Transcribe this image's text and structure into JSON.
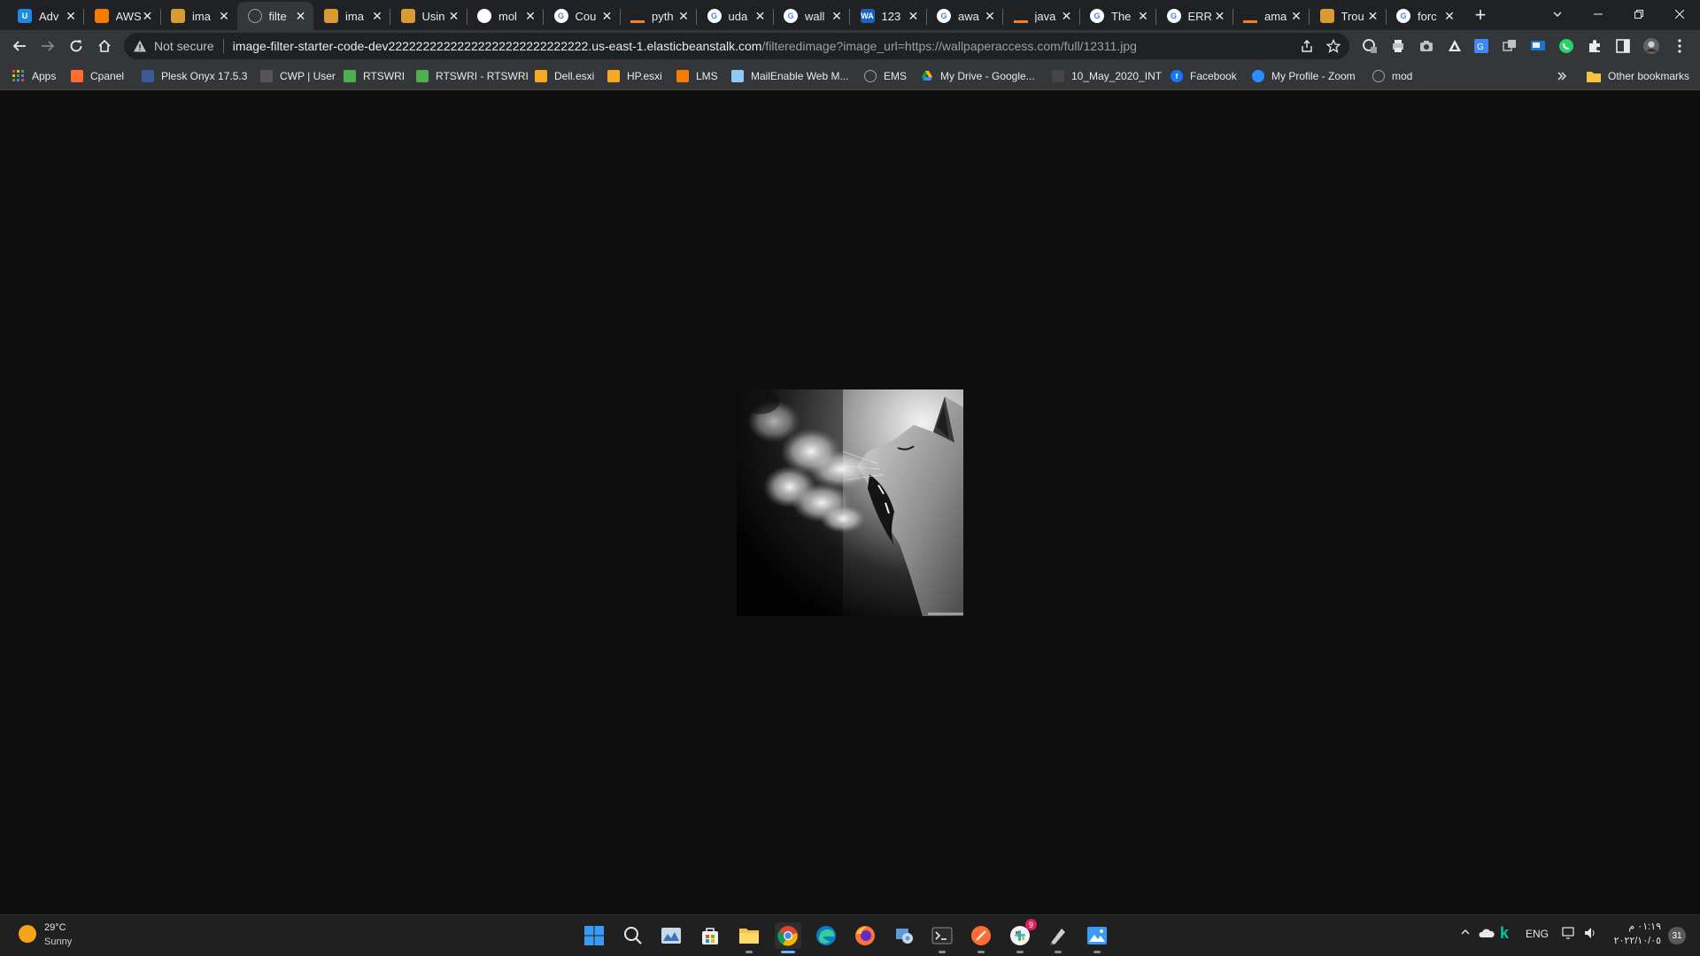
{
  "tabs": [
    {
      "title": "Adv",
      "icon": "udacity-icon",
      "color": "#1e88e5",
      "glyph": "U"
    },
    {
      "title": "AWS",
      "icon": "aws-cube-icon",
      "color": "#f57c00",
      "glyph": ""
    },
    {
      "title": "ima",
      "icon": "package-icon",
      "color": "#d89b33",
      "glyph": ""
    },
    {
      "title": "filte",
      "icon": "globe-icon",
      "color": "#9aa0a6",
      "glyph": "",
      "active": true
    },
    {
      "title": "ima",
      "icon": "package-icon",
      "color": "#d89b33",
      "glyph": ""
    },
    {
      "title": "Usin",
      "icon": "package-icon",
      "color": "#d89b33",
      "glyph": ""
    },
    {
      "title": "mol",
      "icon": "github-icon",
      "color": "#ffffff",
      "glyph": ""
    },
    {
      "title": "Cou",
      "icon": "google-icon",
      "color": "#ffffff",
      "glyph": "G"
    },
    {
      "title": "pyth",
      "icon": "stackoverflow-icon",
      "color": "#f48024",
      "glyph": ""
    },
    {
      "title": "uda",
      "icon": "google-icon",
      "color": "#ffffff",
      "glyph": "G"
    },
    {
      "title": "wall",
      "icon": "google-icon",
      "color": "#ffffff",
      "glyph": "G"
    },
    {
      "title": "123",
      "icon": "wallpaperaccess-icon",
      "color": "#1565c0",
      "glyph": "WA"
    },
    {
      "title": "awa",
      "icon": "google-icon",
      "color": "#ffffff",
      "glyph": "G"
    },
    {
      "title": "java",
      "icon": "stackoverflow-icon",
      "color": "#f48024",
      "glyph": ""
    },
    {
      "title": "The",
      "icon": "google-icon",
      "color": "#ffffff",
      "glyph": "G"
    },
    {
      "title": "ERR",
      "icon": "google-icon",
      "color": "#ffffff",
      "glyph": "G"
    },
    {
      "title": "ama",
      "icon": "stackoverflow-icon",
      "color": "#f48024",
      "glyph": ""
    },
    {
      "title": "Trou",
      "icon": "package-icon",
      "color": "#d89b33",
      "glyph": ""
    },
    {
      "title": "forc",
      "icon": "google-icon",
      "color": "#ffffff",
      "glyph": "G"
    }
  ],
  "omnibox": {
    "security_label": "Not secure",
    "url_host": "image-filter-starter-code-dev22222222222222222222222222222.us-east-1.elasticbeanstalk.com",
    "url_path": "/filteredimage?image_url=https://wallpaperaccess.com/full/12311.jpg"
  },
  "bookmarks": [
    {
      "label": "Apps",
      "icon": "apps-grid-icon",
      "color": "#e94235"
    },
    {
      "label": "Cpanel",
      "icon": "cpanel-icon",
      "color": "#ff6c2c"
    },
    {
      "label": "Plesk Onyx 17.5.3",
      "icon": "plesk-icon",
      "color": "#3d5a98"
    },
    {
      "label": "CWP | User",
      "icon": "cwp-icon",
      "color": "#555555"
    },
    {
      "label": "RTSWRI",
      "icon": "rtswri-icon",
      "color": "#4caf50"
    },
    {
      "label": "RTSWRI - RTSWRI",
      "icon": "rtswri-icon",
      "color": "#4caf50"
    },
    {
      "label": "Dell.esxi",
      "icon": "vmware-icon",
      "color": "#f9a825"
    },
    {
      "label": "HP.esxi",
      "icon": "vmware-icon",
      "color": "#f9a825"
    },
    {
      "label": "LMS",
      "icon": "lms-icon",
      "color": "#f57c00"
    },
    {
      "label": "MailEnable Web M...",
      "icon": "mail-icon",
      "color": "#90caf9"
    },
    {
      "label": "EMS",
      "icon": "globe-icon",
      "color": "#9aa0a6"
    },
    {
      "label": "My Drive - Google...",
      "icon": "google-drive-icon",
      "color": "#fbbc04"
    },
    {
      "label": "10_May_2020_INT",
      "icon": "document-icon",
      "color": "#444444"
    },
    {
      "label": "Facebook",
      "icon": "facebook-icon",
      "color": "#1877f2"
    },
    {
      "label": "My Profile - Zoom",
      "icon": "zoom-icon",
      "color": "#2d8cff"
    },
    {
      "label": "mod",
      "icon": "globe-icon",
      "color": "#9aa0a6"
    }
  ],
  "other_bookmarks_label": "Other bookmarks",
  "weather": {
    "temp": "29°C",
    "condition": "Sunny"
  },
  "tray": {
    "language": "ENG",
    "time": "٠١:١٩ م",
    "date": "٢٠٢٢/١٠/٠٥",
    "notifications": "31"
  },
  "taskbar_apps": [
    {
      "name": "start-button",
      "icon": "windows-logo-icon",
      "active": false,
      "running": false
    },
    {
      "name": "search-button",
      "icon": "search-icon",
      "active": false,
      "running": false
    },
    {
      "name": "widgets-button",
      "icon": "widgets-icon",
      "active": false,
      "running": false
    },
    {
      "name": "store-app",
      "icon": "store-icon",
      "active": false,
      "running": false
    },
    {
      "name": "file-explorer-app",
      "icon": "folder-icon",
      "active": false,
      "running": true
    },
    {
      "name": "chrome-app",
      "icon": "chrome-icon",
      "active": true,
      "running": true
    },
    {
      "name": "edge-app",
      "icon": "edge-icon",
      "active": false,
      "running": false
    },
    {
      "name": "firefox-app",
      "icon": "firefox-icon",
      "active": false,
      "running": false
    },
    {
      "name": "control-panel-app",
      "icon": "control-panel-icon",
      "active": false,
      "running": false
    },
    {
      "name": "terminal-app",
      "icon": "terminal-icon",
      "active": false,
      "running": true
    },
    {
      "name": "postman-app",
      "icon": "postman-icon",
      "active": false,
      "running": true
    },
    {
      "name": "slack-app",
      "icon": "slack-icon",
      "active": false,
      "running": true,
      "badge": "9"
    },
    {
      "name": "pen-app",
      "icon": "pen-icon",
      "active": false,
      "running": true
    },
    {
      "name": "photos-app",
      "icon": "photos-icon",
      "active": false,
      "running": true
    }
  ]
}
